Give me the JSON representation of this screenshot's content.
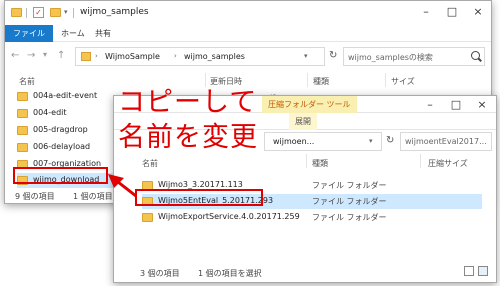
{
  "back_window": {
    "title": "wijmo_samples",
    "ribbon_tabs": [
      "ファイル",
      "ホーム",
      "共有"
    ],
    "address": [
      "WijmoSample",
      "wijmo_samples"
    ],
    "search_placeholder": "wijmo_samplesの検索",
    "columns": {
      "name": "名前",
      "date": "更新日時",
      "type": "種類",
      "size": "サイズ"
    },
    "rows": [
      {
        "name": "004a-edit-event"
      },
      {
        "name": "004-edit"
      },
      {
        "name": "005-dragdrop"
      },
      {
        "name": "006-delayload"
      },
      {
        "name": "007-organization"
      },
      {
        "name": "wijmo_download"
      }
    ],
    "status": "9 個の項目",
    "status_selected": "1 個の項目"
  },
  "front_window": {
    "ribbon_tabs": {
      "context": "圧縮フォルダー ツール",
      "sub": "展開"
    },
    "address": "wijmoen...",
    "search_placeholder": "wijmoentEval2017...",
    "columns": {
      "name": "名前",
      "type": "種類",
      "size": "圧縮サイズ"
    },
    "rows": [
      {
        "name": "Wijmo3_3.20171.113",
        "type": "ファイル フォルダー"
      },
      {
        "name": "Wijmo5EntEval_5.20171.293",
        "type": "ファイル フォルダー"
      },
      {
        "name": "WijmoExportService.4.0.20171.259",
        "type": "ファイル フォルダー"
      }
    ],
    "status": "3 個の項目",
    "status_selected": "1 個の項目を選択"
  },
  "callout": {
    "line1": "コピーして",
    "line2": "名前を変更"
  },
  "colors": {
    "accent": "#1979ca",
    "annotation": "#e00000",
    "selection": "#cde8ff",
    "folder": "#f4c44e"
  }
}
